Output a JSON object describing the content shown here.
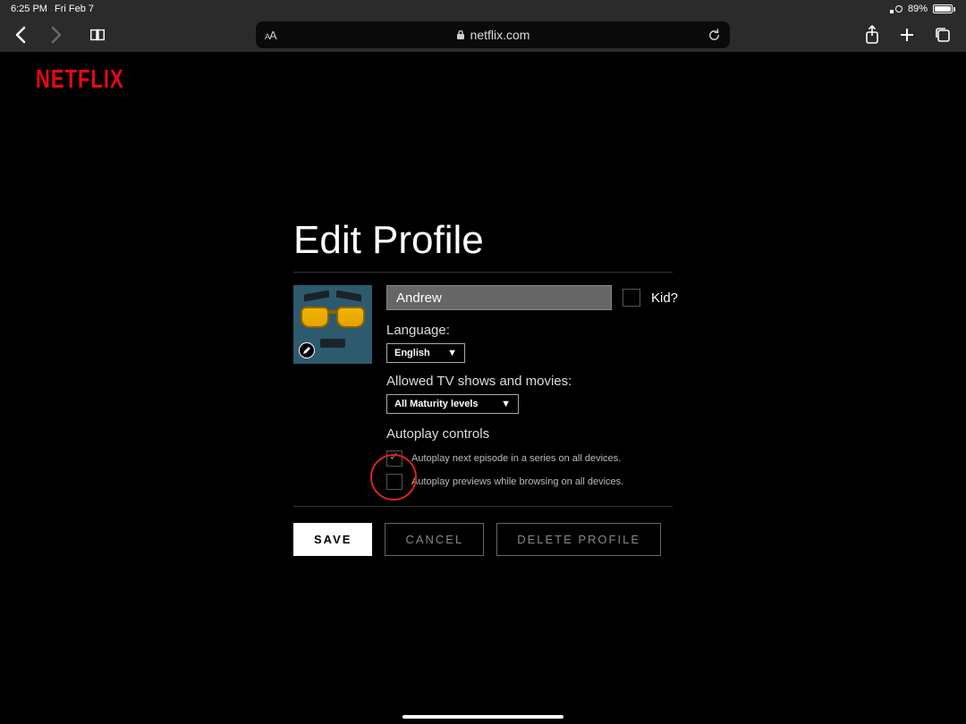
{
  "status": {
    "time": "6:25 PM",
    "date": "Fri Feb 7",
    "battery_pct": "89%"
  },
  "safari": {
    "url_display": "netflix.com",
    "aa": "AA"
  },
  "logo": "NETFLIX",
  "title": "Edit Profile",
  "profile": {
    "name": "Andrew",
    "kid_label": "Kid?",
    "language_label": "Language:",
    "language_value": "English",
    "allowed_label": "Allowed TV shows and movies:",
    "allowed_value": "All Maturity levels",
    "autoplay_title": "Autoplay controls",
    "autoplay_next": "Autoplay next episode in a series on all devices.",
    "autoplay_prev": "Autoplay previews while browsing on all devices."
  },
  "buttons": {
    "save": "SAVE",
    "cancel": "CANCEL",
    "delete": "DELETE PROFILE"
  }
}
